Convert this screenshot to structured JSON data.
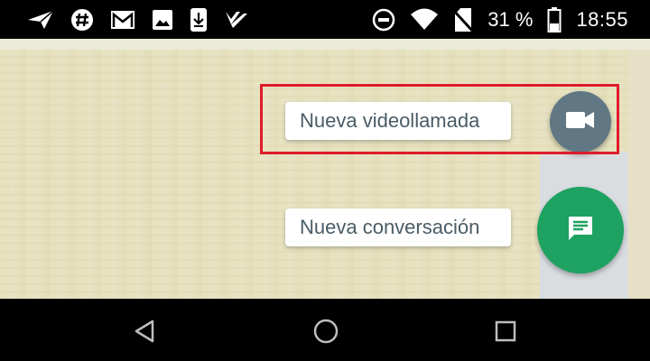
{
  "status_bar": {
    "left_icons": [
      "send-icon",
      "slack-icon",
      "gmail-icon",
      "image-icon",
      "download-icon",
      "check-icon"
    ],
    "right_icons": [
      "do-not-disturb-icon",
      "wifi-icon",
      "no-sim-icon",
      "battery-icon"
    ],
    "battery_percent": "31 %",
    "time": "18:55"
  },
  "fab_menu": {
    "video_call_label": "Nueva videollamada",
    "video_call_icon": "videocam-icon",
    "new_conversation_label": "Nueva conversación",
    "new_conversation_icon": "chat-icon"
  },
  "highlight": {
    "color": "#e01b2a"
  },
  "nav_bar": {
    "buttons": [
      "back-icon",
      "home-icon",
      "recent-apps-icon"
    ]
  },
  "colors": {
    "video_fab": "#617884",
    "conversation_fab": "#1da261"
  }
}
